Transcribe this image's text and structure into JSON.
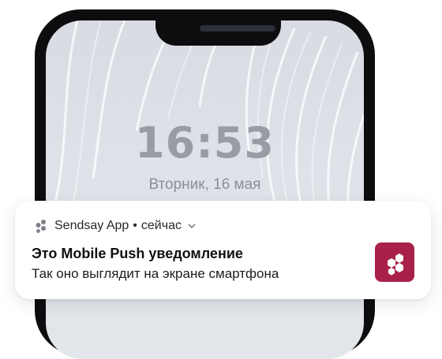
{
  "lock_screen": {
    "time": "16:53",
    "date": "Вторник, 16 мая"
  },
  "notification": {
    "app_name": "Sendsay App",
    "separator": "•",
    "timestamp": "сейчас",
    "title": "Это Mobile Push уведомление",
    "body": "Так оно выглядит на экране смартфона",
    "app_icon": "sendsay-logo-icon",
    "expand_icon": "chevron-down-icon",
    "brand_color": "#a92148"
  }
}
